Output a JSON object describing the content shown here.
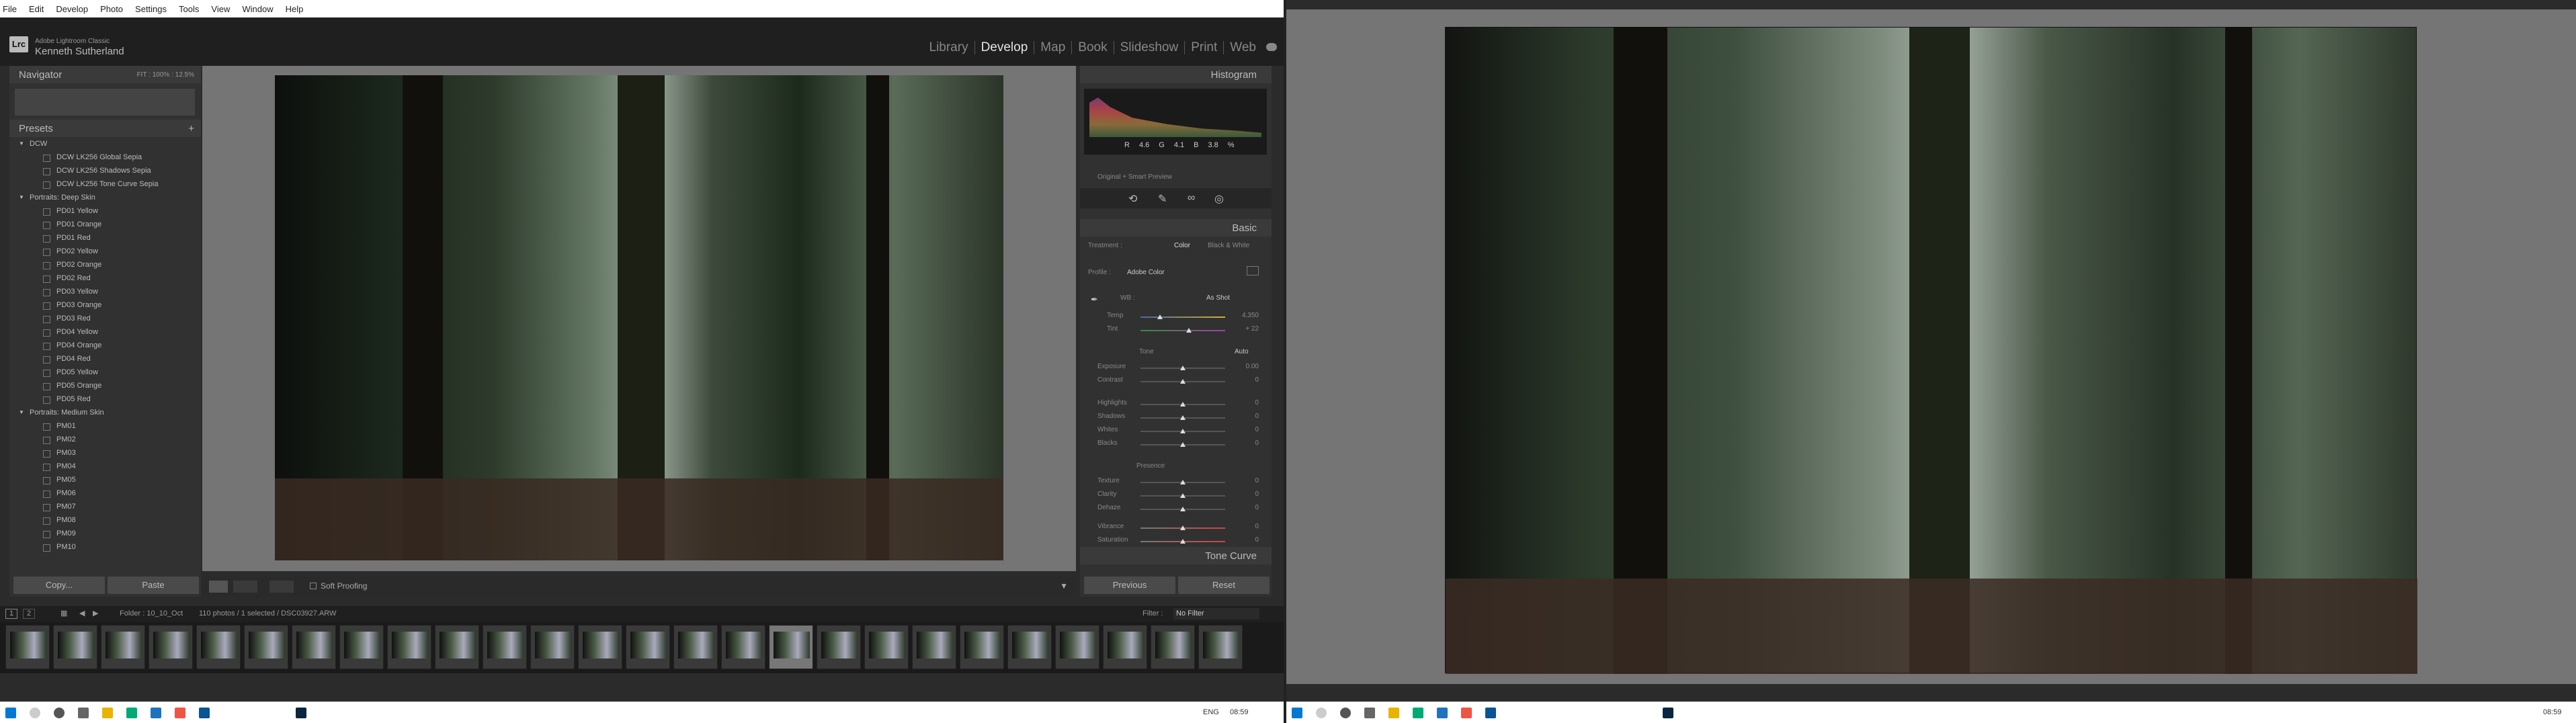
{
  "menu": [
    "File",
    "Edit",
    "Develop",
    "Photo",
    "Settings",
    "Tools",
    "View",
    "Window",
    "Help"
  ],
  "identity": {
    "logo": "Lrc",
    "app": "Adobe Lightroom Classic",
    "user": "Kenneth Sutherland"
  },
  "modules": [
    "Library",
    "Develop",
    "Map",
    "Book",
    "Slideshow",
    "Print",
    "Web"
  ],
  "active_module": "Develop",
  "navigator": {
    "title": "Navigator",
    "zoom": "FIT : 100% : 12.5%"
  },
  "presets": {
    "title": "Presets",
    "groups": [
      {
        "name": "DCW",
        "items": [
          "DCW LK256 Global Sepia",
          "DCW LK256 Shadows Sepia",
          "DCW LK256 Tone Curve Sepia"
        ]
      },
      {
        "name": "Portraits: Deep Skin",
        "items": [
          "PD01 Yellow",
          "PD01 Orange",
          "PD01 Red",
          "PD02 Yellow",
          "PD02 Orange",
          "PD02 Red",
          "PD03 Yellow",
          "PD03 Orange",
          "PD03 Red",
          "PD04 Yellow",
          "PD04 Orange",
          "PD04 Red",
          "PD05 Yellow",
          "PD05 Orange",
          "PD05 Red"
        ]
      },
      {
        "name": "Portraits: Medium Skin",
        "items": [
          "PM01",
          "PM02",
          "PM03",
          "PM04",
          "PM05",
          "PM06",
          "PM07",
          "PM08",
          "PM09",
          "PM10"
        ]
      }
    ]
  },
  "left_buttons": {
    "copy": "Copy...",
    "paste": "Paste"
  },
  "toolbar": {
    "soft_proofing": "Soft Proofing"
  },
  "histogram": {
    "title": "Histogram",
    "r": "R",
    "r_val": "4.6",
    "g": "G",
    "g_val": "4.1",
    "b": "B",
    "b_val": "3.8",
    "pct": "%",
    "preview": "Original + Smart Preview"
  },
  "basic": {
    "title": "Basic",
    "treatment_label": "Treatment :",
    "color": "Color",
    "bw": "Black & White",
    "profile_label": "Profile :",
    "profile": "Adobe Color",
    "wb_label": "WB :",
    "wb": "As Shot",
    "temp_label": "Temp",
    "temp": "4,350",
    "tint_label": "Tint",
    "tint": "+ 22",
    "tone_label": "Tone",
    "auto": "Auto",
    "exposure_label": "Exposure",
    "exposure": "0.00",
    "contrast_label": "Contrast",
    "contrast": "0",
    "highlights_label": "Highlights",
    "highlights": "0",
    "shadows_label": "Shadows",
    "shadows": "0",
    "whites_label": "Whites",
    "whites": "0",
    "blacks_label": "Blacks",
    "blacks": "0",
    "presence_label": "Presence",
    "texture_label": "Texture",
    "texture": "0",
    "clarity_label": "Clarity",
    "clarity": "0",
    "dehaze_label": "Dehaze",
    "dehaze": "0",
    "vibrance_label": "Vibrance",
    "vibrance": "0",
    "saturation_label": "Saturation",
    "saturation": "0"
  },
  "tone_curve": "Tone Curve",
  "right_buttons": {
    "previous": "Previous",
    "reset": "Reset"
  },
  "filmbar": {
    "page1": "1",
    "page2": "2",
    "folder": "Folder : 10_10_Oct",
    "count": "110 photos / 1 selected / DSC03927.ARW",
    "filter_label": "Filter :",
    "filter": "No Filter"
  },
  "filmstrip_count": 26,
  "selected_thumb": 16,
  "tray1": {
    "lang": "ENG",
    "time": "08:59"
  },
  "tray2": {
    "time": "08:59"
  }
}
